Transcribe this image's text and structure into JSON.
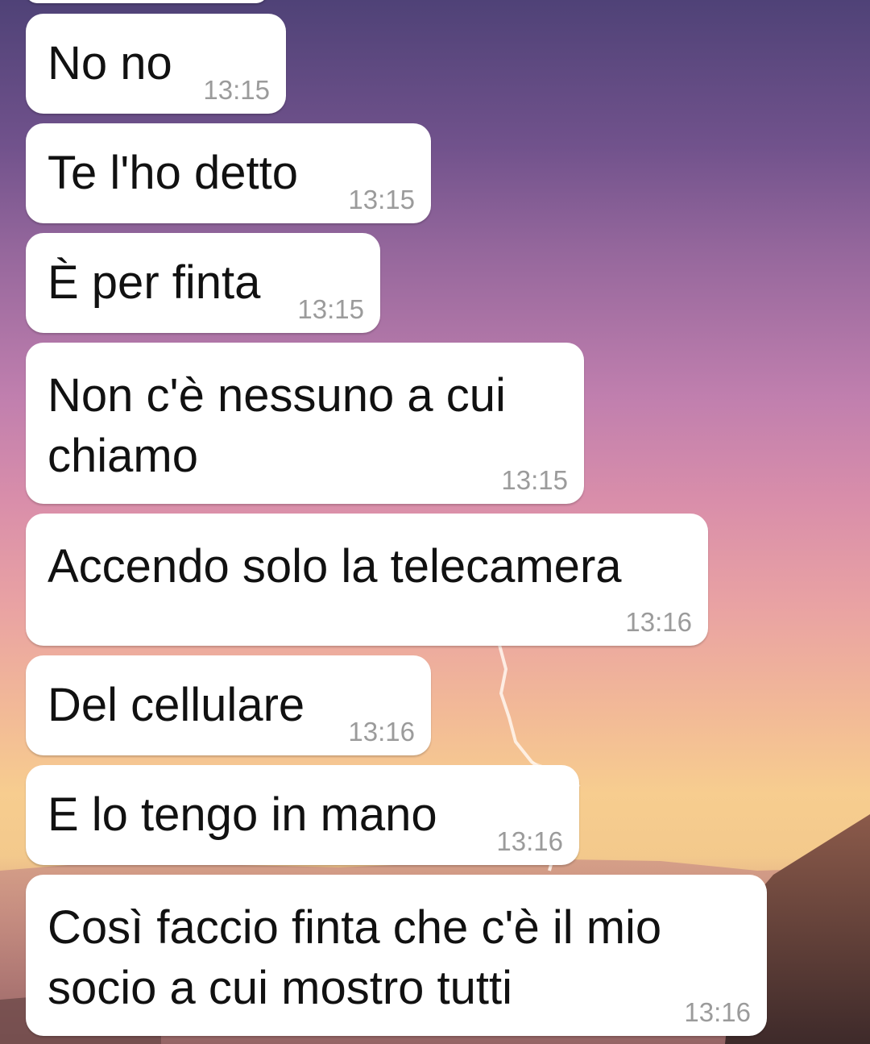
{
  "chat": {
    "messages": [
      {
        "text": "No no",
        "time": "13:15"
      },
      {
        "text": "Te l'ho detto",
        "time": "13:15"
      },
      {
        "text": "È per finta",
        "time": "13:15"
      },
      {
        "text": "Non c'è nessuno a cui\nchiamo",
        "time": "13:15"
      },
      {
        "text": "Accendo solo la telecamera",
        "time": "13:16"
      },
      {
        "text": "Del cellulare",
        "time": "13:16"
      },
      {
        "text": "E lo tengo in mano",
        "time": "13:16"
      },
      {
        "text": "Così faccio finta che c'è il mio\nsocio a cui mostro tutti",
        "time": "13:16"
      }
    ]
  }
}
